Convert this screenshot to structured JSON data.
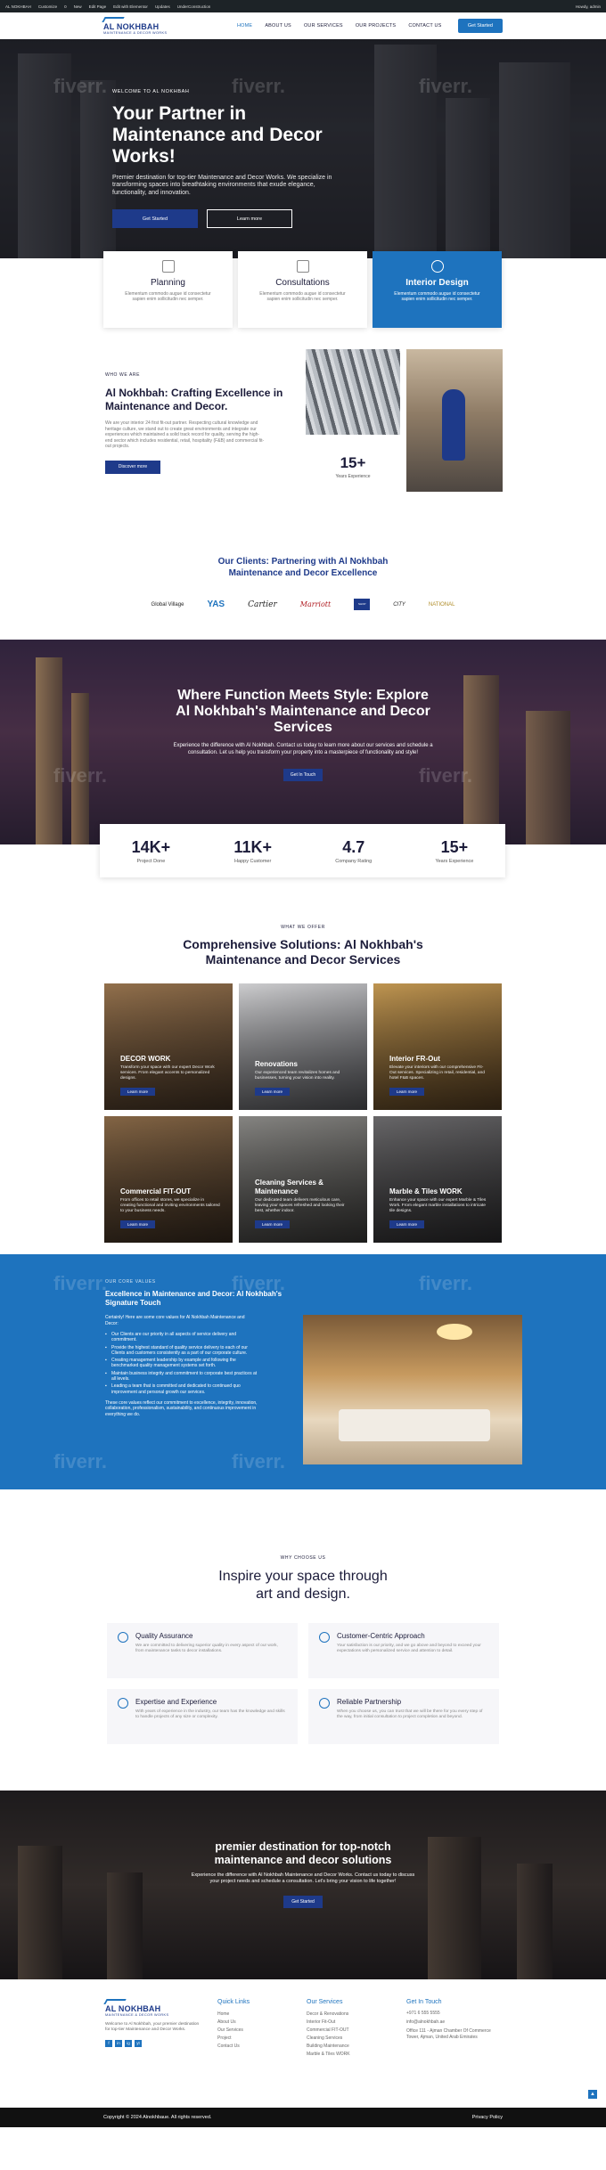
{
  "adminbar": {
    "items": [
      "AL NOKHBAH",
      "Customize",
      "0",
      "New",
      "Edit Page",
      "Edit with Elementor",
      "Updates",
      "UnderConstruction"
    ],
    "user": "Howdy, admin"
  },
  "header": {
    "logo_brand": "AL NOKHBAH",
    "logo_tag": "MAINTENANCE & DECOR WORKS",
    "nav": [
      "HOME",
      "ABOUT US",
      "OUR SERVICES",
      "OUR PROJECTS",
      "CONTACT US"
    ],
    "cta": "Get Started"
  },
  "hero": {
    "eyebrow": "WELCOME TO AL NOKHBAH",
    "title": "Your Partner in Maintenance and Decor Works!",
    "body": "Premier destination for top-tier Maintenance and Decor Works. We specialize in transforming spaces into breathtaking environments that exude elegance, functionality, and innovation.",
    "btn_primary": "Get Started",
    "btn_secondary": "Learn more"
  },
  "features": [
    {
      "title": "Planning",
      "text": "Elementum commodo augue id consectetur sapien enim sollicitudin nec semper."
    },
    {
      "title": "Consultations",
      "text": "Elementum commodo augue id consectetur sapien enim sollicitudin nec semper."
    },
    {
      "title": "Interior Design",
      "text": "Elementum commodo augue id consectetur sapien enim sollicitudin nec semper."
    }
  ],
  "about": {
    "eyebrow": "WHO WE ARE",
    "title": "Al Nokhbah: Crafting Excellence in Maintenance and Decor.",
    "body": "We are your interior 24 first fit-out partner. Respecting cultural knowledge and heritage culture, we stand out to create great environments and integrate our experiences which maintained a solid track record for quality, serving the high-end sector which includes residential, retail, hospitality (F&B) and commercial fit-out projects.",
    "button": "Discover more",
    "years": "15+",
    "years_label": "Years Experience"
  },
  "clients": {
    "title": "Our Clients: Partnering with Al Nokhbah Maintenance and Decor Excellence",
    "logos": [
      "Global Village",
      "YAS",
      "Cartier",
      "Marriott",
      "SHOP",
      "CITY",
      "NATIONAL"
    ]
  },
  "services_banner": {
    "title": "Where Function Meets Style: Explore Al Nokhbah's Maintenance and Decor Services",
    "body": "Experience the difference with Al Nokhbah. Contact us today to learn more about our services and schedule a consultation. Let us help you transform your property into a masterpiece of functionality and style!",
    "button": "Get In Touch"
  },
  "stats": [
    {
      "value": "14K+",
      "label": "Project Done"
    },
    {
      "value": "11K+",
      "label": "Happy Customer"
    },
    {
      "value": "4.7",
      "label": "Company Rating"
    },
    {
      "value": "15+",
      "label": "Years Experience"
    }
  ],
  "solutions": {
    "eyebrow": "WHAT WE OFFER",
    "title": "Comprehensive Solutions: Al Nokhbah's Maintenance and Decor Services",
    "items": [
      {
        "title": "DECOR WORK",
        "text": "Transform your space with our expert Decor Work services. From elegant accents to personalized designs.",
        "button": "Learn more"
      },
      {
        "title": "Renovations",
        "text": "Our experienced team revitalizes homes and businesses, turning your vision into reality.",
        "button": "Learn more"
      },
      {
        "title": "Interior FR-Out",
        "text": "Elevate your interiors with our comprehensive Fit-Out services. Specializing in retail, residential, and hotel F&B spaces.",
        "button": "Learn more"
      },
      {
        "title": "Commercial FIT-OUT",
        "text": "From offices to retail stores, we specialize in creating functional and inviting environments tailored to your business needs.",
        "button": "Learn more"
      },
      {
        "title": "Cleaning Services & Maintenance",
        "text": "Our dedicated team delivers meticulous care, leaving your spaces refreshed and looking their best, whether indoor.",
        "button": "Learn more"
      },
      {
        "title": "Marble & Tiles WORK",
        "text": "Enhance your space with our expert Marble & Tiles Work. From elegant marble installations to intricate tile designs.",
        "button": "Learn more"
      }
    ]
  },
  "values": {
    "eyebrow": "OUR CORE VALUES",
    "title": "Excellence in Maintenance and Decor: Al Nokhbah's Signature Touch",
    "intro": "Certainly! Here are some core values for Al Nokhbah Maintenance and Decor:",
    "list": [
      "Our Clients are our priority in all aspects of service delivery and commitment.",
      "Provide the highest standard of quality service delivery to each of our Clients and customers consistently as a part of our corporate culture.",
      "Creating management leadership by example and following the benchmarked quality management systems set forth.",
      "Maintain business integrity and commitment to corporate best practices at all levels.",
      "Leading a team that is committed and dedicated to continued quo improvement and personal growth our services."
    ],
    "outro": "These core values reflect our commitment to excellence, integrity, innovation, collaboration, professionalism, sustainability, and continuous improvement in everything we do."
  },
  "why": {
    "eyebrow": "WHY CHOOSE US",
    "title": "Inspire your space through art and design.",
    "items": [
      {
        "title": "Quality Assurance",
        "text": "We are committed to delivering superior quality in every aspect of our work, from maintenance tasks to decor installations."
      },
      {
        "title": "Customer-Centric Approach",
        "text": "Your satisfaction is our priority, and we go above and beyond to exceed your expectations with personalized service and attention to detail."
      },
      {
        "title": "Expertise and Experience",
        "text": "With years of experience in the industry, our team has the knowledge and skills to handle projects of any size or complexity."
      },
      {
        "title": "Reliable Partnership",
        "text": "When you choose us, you can trust that we will be there for you every step of the way, from initial consultation to project completion and beyond."
      }
    ]
  },
  "city": {
    "title": "premier destination for top-notch maintenance and decor solutions",
    "body": "Experience the difference with Al Nokhbah Maintenance and Decor Works. Contact us today to discuss your project needs and schedule a consultation. Let's bring your vision to life together!",
    "button": "Get Started"
  },
  "footer": {
    "about": "Welcome to Al Nokhbah, your premier destination for top-tier Maintenance and Decor Works.",
    "socials": [
      "f",
      "in",
      "ig",
      "yt"
    ],
    "quick_title": "Quick Links",
    "quick": [
      "Home",
      "About Us",
      "Our Services",
      "Project",
      "Contact Us"
    ],
    "services_title": "Our Services",
    "services": [
      "Decor & Renovations",
      "Interior Fit-Out",
      "Commercial FIT-OUT",
      "Cleaning Services",
      "Building Maintenance",
      "Marble & Tiles WORK"
    ],
    "contact_title": "Get In Touch",
    "contact": [
      "+971 6 555 5555",
      "info@alnokhbah.ae",
      "Office 111 - Ajman Chamber Of Commerce Tower, Ajman, United Arab Emirates"
    ],
    "copyright": "Copyright © 2024 Alnokhbaue. All rights reserved.",
    "privacy": "Privacy Policy"
  },
  "watermark": "fiverr."
}
